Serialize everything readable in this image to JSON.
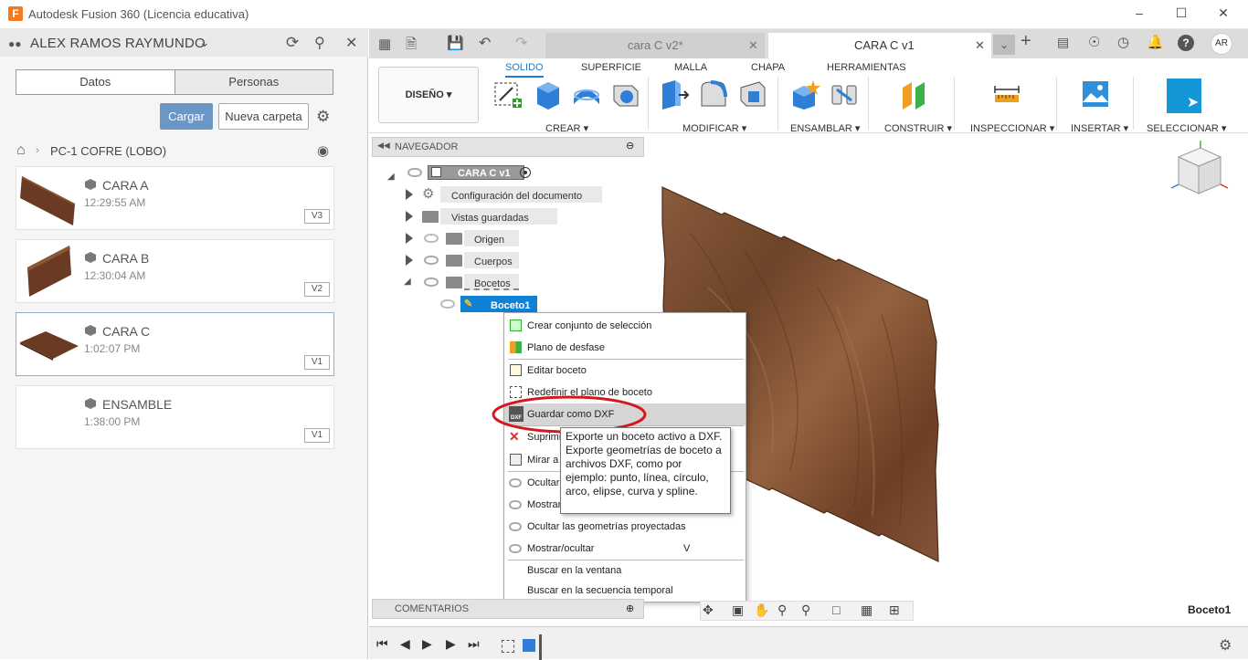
{
  "titlebar": {
    "app_title": "Autodesk Fusion 360 (Licencia educativa)",
    "logo": "F"
  },
  "data_panel": {
    "user_name": "ALEX RAMOS RAYMUNDO",
    "tabs": [
      "Datos",
      "Personas"
    ],
    "upload_label": "Cargar",
    "new_folder_label": "Nueva carpeta",
    "breadcrumb": "PC-1 COFRE (LOBO)",
    "files": [
      {
        "name": "CARA A",
        "time": "12:29:55 AM",
        "version": "V3"
      },
      {
        "name": "CARA B",
        "time": "12:30:04 AM",
        "version": "V2"
      },
      {
        "name": "CARA C",
        "time": "1:02:07 PM",
        "version": "V1"
      },
      {
        "name": "ENSAMBLE",
        "time": "1:38:00 PM",
        "version": "V1"
      }
    ]
  },
  "doc_tabs": [
    {
      "label": "cara C v2*"
    },
    {
      "label": "CARA C v1"
    }
  ],
  "user_initials": "AR",
  "ribbon": {
    "workspace": "DISEÑO",
    "tabs": [
      "SOLIDO",
      "SUPERFICIE",
      "MALLA",
      "CHAPA",
      "HERRAMIENTAS"
    ],
    "groups": [
      "CREAR",
      "MODIFICAR",
      "ENSAMBLAR",
      "CONSTRUIR",
      "INSPECCIONAR",
      "INSERTAR",
      "SELECCIONAR"
    ]
  },
  "browser": {
    "title": "NAVEGADOR",
    "root": "CARA C v1",
    "items": [
      "Configuración del documento",
      "Vistas guardadas",
      "Origen",
      "Cuerpos",
      "Bocetos"
    ],
    "sketch": "Boceto1"
  },
  "context_menu": {
    "items": [
      "Crear conjunto de selección",
      "Plano de desfase",
      "Editar boceto",
      "Redefinir el plano de boceto",
      "Guardar como DXF",
      "Suprimir",
      "Mirar a",
      "Ocultar",
      "Mostrar",
      "Ocultar las geometrías proyectadas",
      "Mostrar/ocultar",
      "Buscar en la ventana",
      "Buscar en la secuencia temporal"
    ],
    "shortcut_toggle": "V",
    "dxf_badge": "DXF"
  },
  "tooltip": {
    "text": "Exporte un boceto activo a DXF. Exporte geometrías de boceto a archivos DXF, como por ejemplo: punto, línea, círculo, arco, elipse, curva y spline."
  },
  "comments_label": "COMENTARIOS",
  "status_selection": "Boceto1",
  "colors": {
    "accent": "#1a7fd1",
    "highlight_circle": "#d3191f",
    "wood": "#7a4a2c"
  }
}
